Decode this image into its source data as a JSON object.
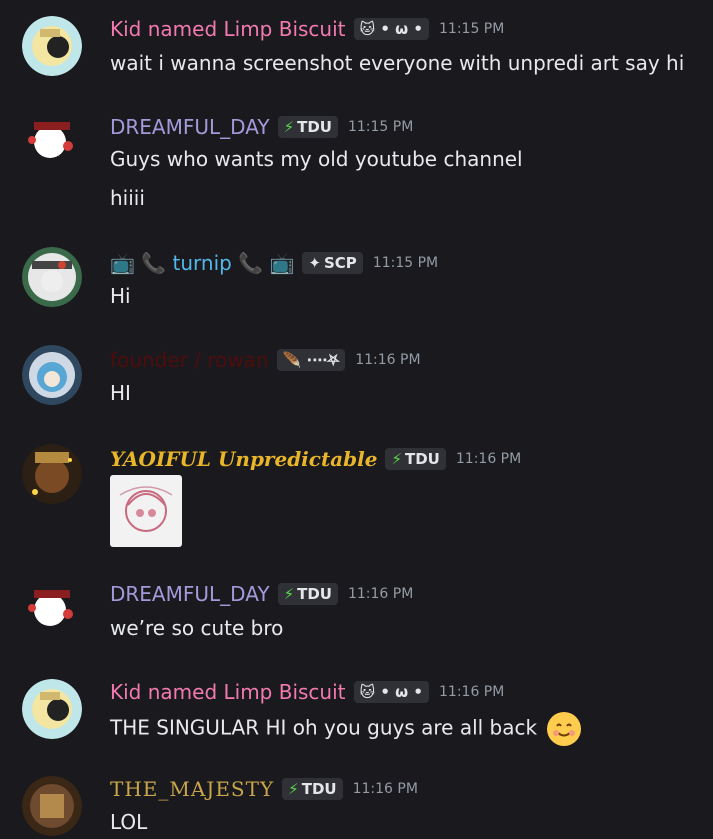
{
  "messages": [
    {
      "username": "Kid named Limp Biscuit",
      "tag": "🐱 • ω •",
      "time": "11:15 PM",
      "lines": [
        "wait i wanna screenshot everyone with unpredi art say hi"
      ]
    },
    {
      "username": "DREAMFUL_DAY",
      "tag": "TDU",
      "time": "11:15 PM",
      "lines": [
        "Guys who wants my old youtube channel",
        "hiiii"
      ]
    },
    {
      "username": "turnip",
      "tag": "SCP",
      "time": "11:15 PM",
      "lines": [
        "Hi"
      ]
    },
    {
      "username": "founder / rowan",
      "tag": "🪶 ⋅⋯⛧",
      "time": "11:16 PM",
      "lines": [
        "HI"
      ]
    },
    {
      "username": "YAOIFUL Unpredictable",
      "tag": "TDU",
      "time": "11:16 PM",
      "lines": []
    },
    {
      "username": "DREAMFUL_DAY",
      "tag": "TDU",
      "time": "11:16 PM",
      "lines": [
        "we’re so cute bro"
      ]
    },
    {
      "username": "Kid named Limp Biscuit",
      "tag": "🐱 • ω •",
      "time": "11:16 PM",
      "lines": [
        "THE SINGULAR HI oh you guys are all back"
      ]
    },
    {
      "username": "THE_MAJESTY",
      "tag": "TDU",
      "time": "11:16 PM",
      "lines": [
        "LOL"
      ]
    }
  ],
  "icons": {
    "tv": "📺",
    "phone": "📞",
    "bolt": "⚡",
    "scp": "✦",
    "smile": "😊"
  },
  "colors": {
    "background": "#1a1a1e",
    "pink": "#f27ab0",
    "purple": "#a39adb",
    "blue": "#54b6e8",
    "darkred": "#4e0d0d",
    "gold": "#e9b62a",
    "time": "#949ba4"
  }
}
